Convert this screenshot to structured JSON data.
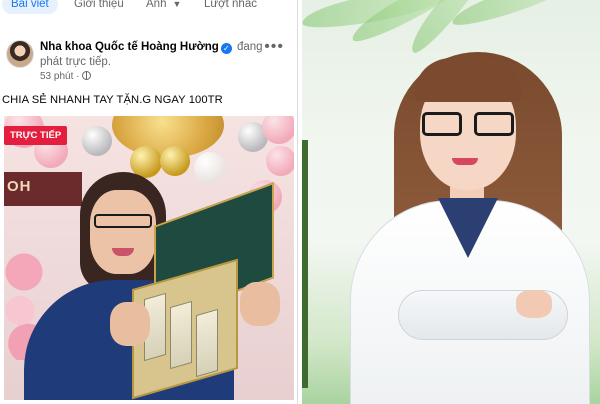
{
  "tabs": [
    {
      "label": "Bài viết",
      "active": true
    },
    {
      "label": "Giới thiệu",
      "active": false
    },
    {
      "label": "Ảnh",
      "active": false
    },
    {
      "label": "Lượt nhắc",
      "active": false
    }
  ],
  "post": {
    "author": "Nha khoa Quốc tế Hoàng Hường",
    "status": "đang phát trực tiếp.",
    "time": "53 phút ·",
    "caption": "CHIA SẺ NHANH TAY TẶN.G NGAY 100TR",
    "live_badge": "TRỰC TIẾP",
    "banner_text": "OH"
  },
  "colors": {
    "facebook_blue": "#1877f2",
    "live_red": "#e41e3f",
    "scrub_navy": "#1f3b79"
  }
}
